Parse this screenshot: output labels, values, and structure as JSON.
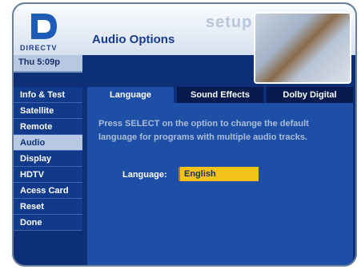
{
  "header": {
    "brand": "DIRECTV",
    "title": "Audio Options",
    "section": "setup"
  },
  "status": {
    "time": "Thu 5:09p"
  },
  "sidebar": {
    "items": [
      {
        "label": "Info & Test"
      },
      {
        "label": "Satellite"
      },
      {
        "label": "Remote"
      },
      {
        "label": "Audio",
        "active": true
      },
      {
        "label": "Display"
      },
      {
        "label": "HDTV"
      },
      {
        "label": "Acess Card"
      },
      {
        "label": "Reset"
      },
      {
        "label": "Done"
      }
    ]
  },
  "tabs": [
    {
      "label": "Language",
      "active": true
    },
    {
      "label": "Sound Effects"
    },
    {
      "label": "Dolby Digital"
    }
  ],
  "content": {
    "instructions": "Press SELECT on the option to change the default language for programs with multiple audio tracks.",
    "language_label": "Language:",
    "language_value": "English"
  },
  "colors": {
    "background": "#0d2f78",
    "panel": "#1e4fa6",
    "highlight": "#f5c21a",
    "active_menu": "#b7c9e2"
  }
}
